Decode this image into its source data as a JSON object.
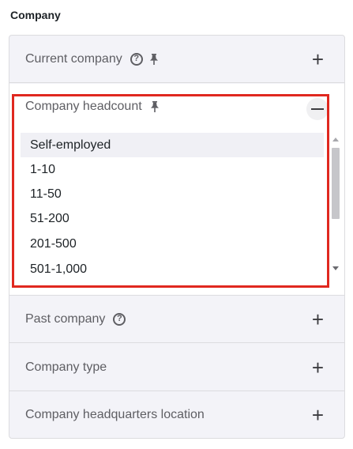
{
  "section": {
    "title": "Company"
  },
  "filters": {
    "current_company": {
      "label": "Current company",
      "action": "+"
    },
    "company_headcount": {
      "label": "Company headcount",
      "options": [
        "Self-employed",
        "1-10",
        "11-50",
        "51-200",
        "201-500",
        "501-1,000"
      ],
      "selected": "Self-employed"
    },
    "past_company": {
      "label": "Past company",
      "action": "+"
    },
    "company_type": {
      "label": "Company type",
      "action": "+"
    },
    "company_hq_location": {
      "label": "Company headquarters location",
      "action": "+"
    }
  },
  "icons": {
    "help": "?",
    "pin": "pin-icon",
    "plus": "+",
    "minus": "minus-icon"
  },
  "colors": {
    "highlight": "#e0281f",
    "panel_bg": "#f3f3f8",
    "text_muted": "#5e5e63"
  }
}
